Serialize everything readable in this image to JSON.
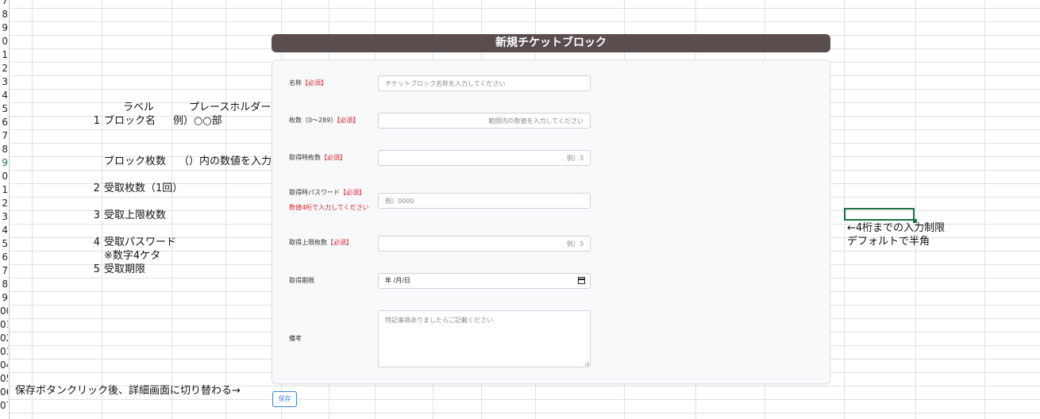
{
  "sheet": {
    "row_numbers": [
      "7",
      "8",
      "9",
      "0",
      "1",
      "2",
      "3",
      "4",
      "5",
      "6",
      "7",
      "8",
      "9",
      "0",
      "1",
      "2",
      "3",
      "4",
      "5",
      "6",
      "7",
      "8",
      "9",
      "00",
      "01",
      "02",
      "03",
      "04",
      "05",
      "06",
      "07"
    ],
    "active_row_label": "2",
    "header_label": "ラベル",
    "header_placeholder": "プレースホルダー",
    "item1_num": "1",
    "item1_label": "ブロック名",
    "item1_placeholder": "例）○○部",
    "item_count_label": "ブロック枚数",
    "item_count_placeholder": "（）内の数値を入力",
    "item2_num": "2",
    "item2_label": "受取枚数（1回）",
    "item3_num": "3",
    "item3_label": "受取上限枚数",
    "item4_num": "4",
    "item4_label": "受取パスワード",
    "item4_note": "※数字4ケタ",
    "item5_num": "5",
    "item5_label": "受取期限",
    "note_save": "保存ボタンクリック後、詳細画面に切り替わる→",
    "note_password_1": "←4桁までの入力制限",
    "note_password_2": "デフォルトで半角"
  },
  "form": {
    "title": "新規チケットブロック",
    "name_label": "名称",
    "name_required": "【必須】",
    "name_placeholder": "チケットブロック名称を入力してください",
    "count_label": "枚数（0〜289）",
    "count_required": "【必須】",
    "count_placeholder": "範囲内の数値を入力してください",
    "per_get_label": "取得時枚数",
    "per_get_required": "【必須】",
    "per_get_placeholder": "例）3",
    "password_label": "取得時パスワード",
    "password_required": "【必須】",
    "password_hint": "数値4桁で入力してください",
    "password_placeholder": "例）0000",
    "limit_label": "取得上限枚数",
    "limit_required": "【必須】",
    "limit_placeholder": "例）3",
    "deadline_label": "取得期限",
    "deadline_value": "年 /月/日",
    "remarks_label": "備考",
    "remarks_placeholder": "特記事項ありましたらご記載ください",
    "save_label": "保存"
  }
}
